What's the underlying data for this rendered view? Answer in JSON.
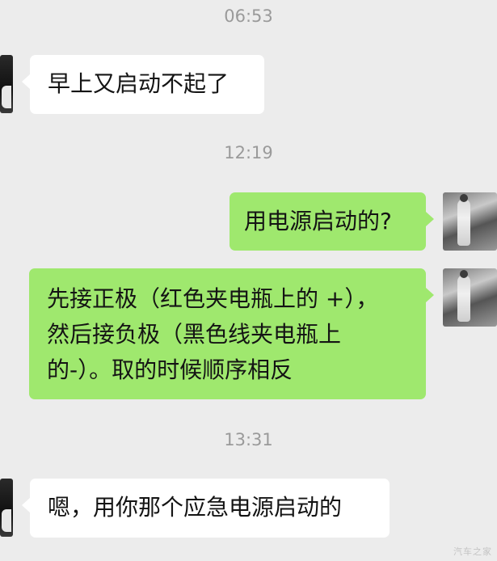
{
  "chat": {
    "messages": [
      {
        "type": "time",
        "text": "06:53"
      },
      {
        "type": "message",
        "side": "left",
        "lines": [
          "早上又启动不起了"
        ]
      },
      {
        "type": "time",
        "text": "12:19"
      },
      {
        "type": "message",
        "side": "right",
        "lines": [
          "用电源启动的?"
        ]
      },
      {
        "type": "message",
        "side": "left",
        "lines": [
          "先接正极（红色夹电瓶上的 +），",
          "然后接负极（黑色线夹电瓶上",
          "的-）。取的时候顺序相反"
        ]
      },
      {
        "type": "time",
        "text": "13:31"
      },
      {
        "type": "message",
        "side": "left",
        "lines": [
          "嗯，用你那个应急电源启动的"
        ]
      }
    ]
  },
  "watermark": "汽车之家",
  "colors": {
    "background": "#ececec",
    "incoming_bubble": "#ffffff",
    "outgoing_bubble": "#9fe86e",
    "timestamp": "#9a9a9a"
  }
}
